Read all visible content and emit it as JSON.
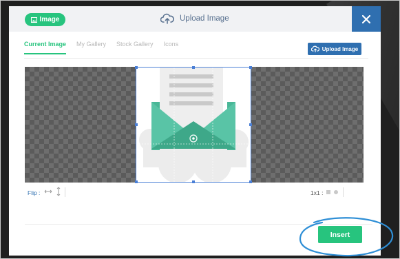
{
  "header": {
    "badge_label": "Image",
    "title": "Upload Image",
    "close_icon": "close-icon"
  },
  "tabs": [
    {
      "label": "Current Image",
      "active": true
    },
    {
      "label": "My Gallery",
      "active": false
    },
    {
      "label": "Stock Gallery",
      "active": false
    },
    {
      "label": "Icons",
      "active": false
    }
  ],
  "upload_button": {
    "label": "Upload Image",
    "icon": "cloud-upload-icon"
  },
  "toolbar": {
    "flip_label": "Flip :",
    "flip_horizontal_icon": "flip-horizontal-icon",
    "flip_vertical_icon": "flip-vertical-icon",
    "ratio_label": "1x1 :"
  },
  "footer": {
    "insert_label": "Insert"
  },
  "colors": {
    "accent_green": "#27c47e",
    "accent_blue": "#2f6fb0",
    "envelope_teal": "#4dbf9e",
    "highlight_ring": "#2f8fd6"
  }
}
